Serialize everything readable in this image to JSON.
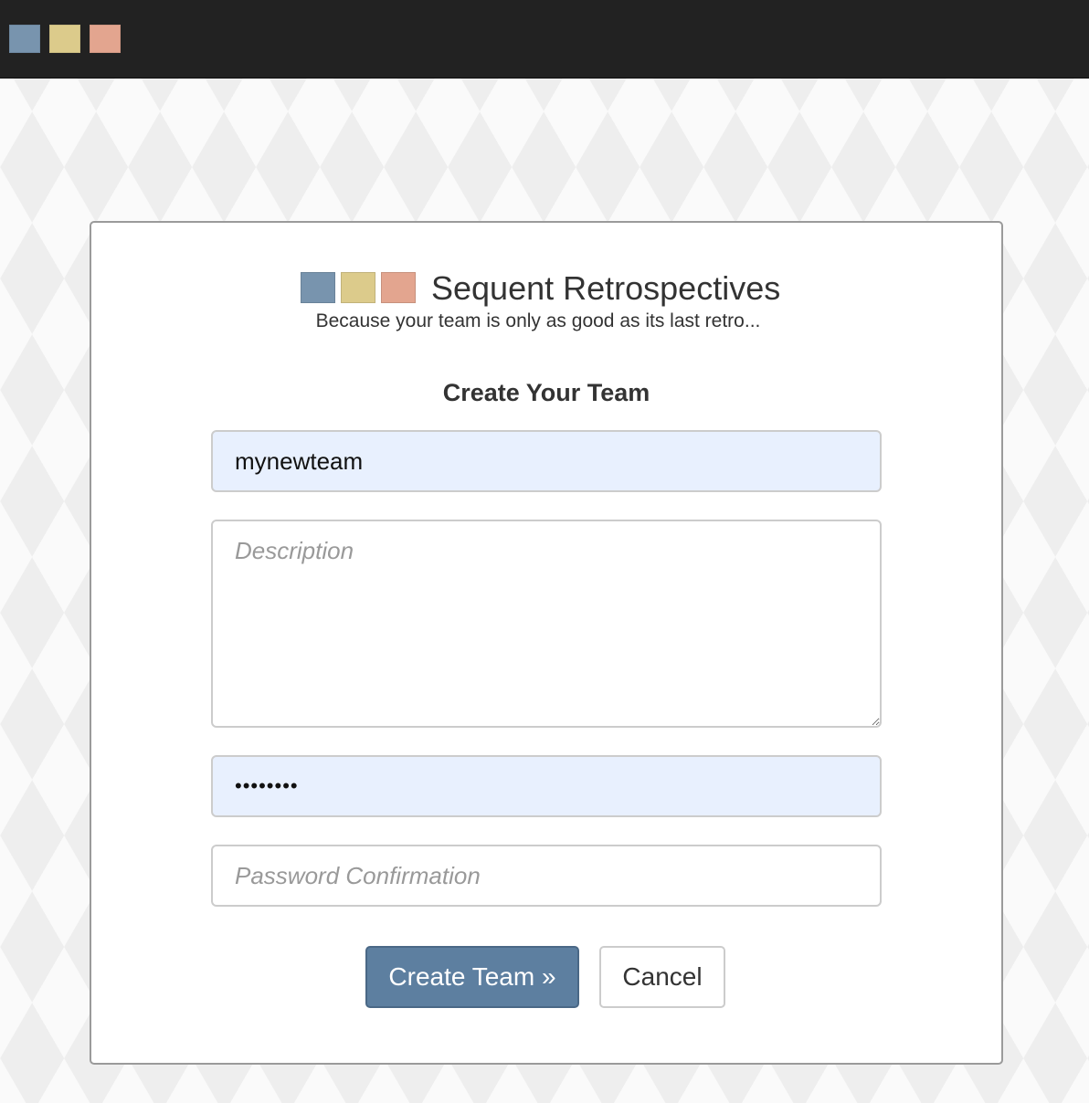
{
  "colors": {
    "square_blue": "#7894ae",
    "square_yellow": "#dccb8b",
    "square_salmon": "#e3a58f",
    "primary_button": "#5d7fa0",
    "autofill_bg": "#e8f0fe"
  },
  "brand": {
    "title": "Sequent Retrospectives",
    "tagline": "Because your team is only as good as its last retro..."
  },
  "form": {
    "title": "Create Your Team",
    "name_value": "mynewteam",
    "description_placeholder": "Description",
    "password_value": "••••••••",
    "password_confirmation_placeholder": "Password Confirmation",
    "submit_label": "Create Team »",
    "cancel_label": "Cancel"
  }
}
